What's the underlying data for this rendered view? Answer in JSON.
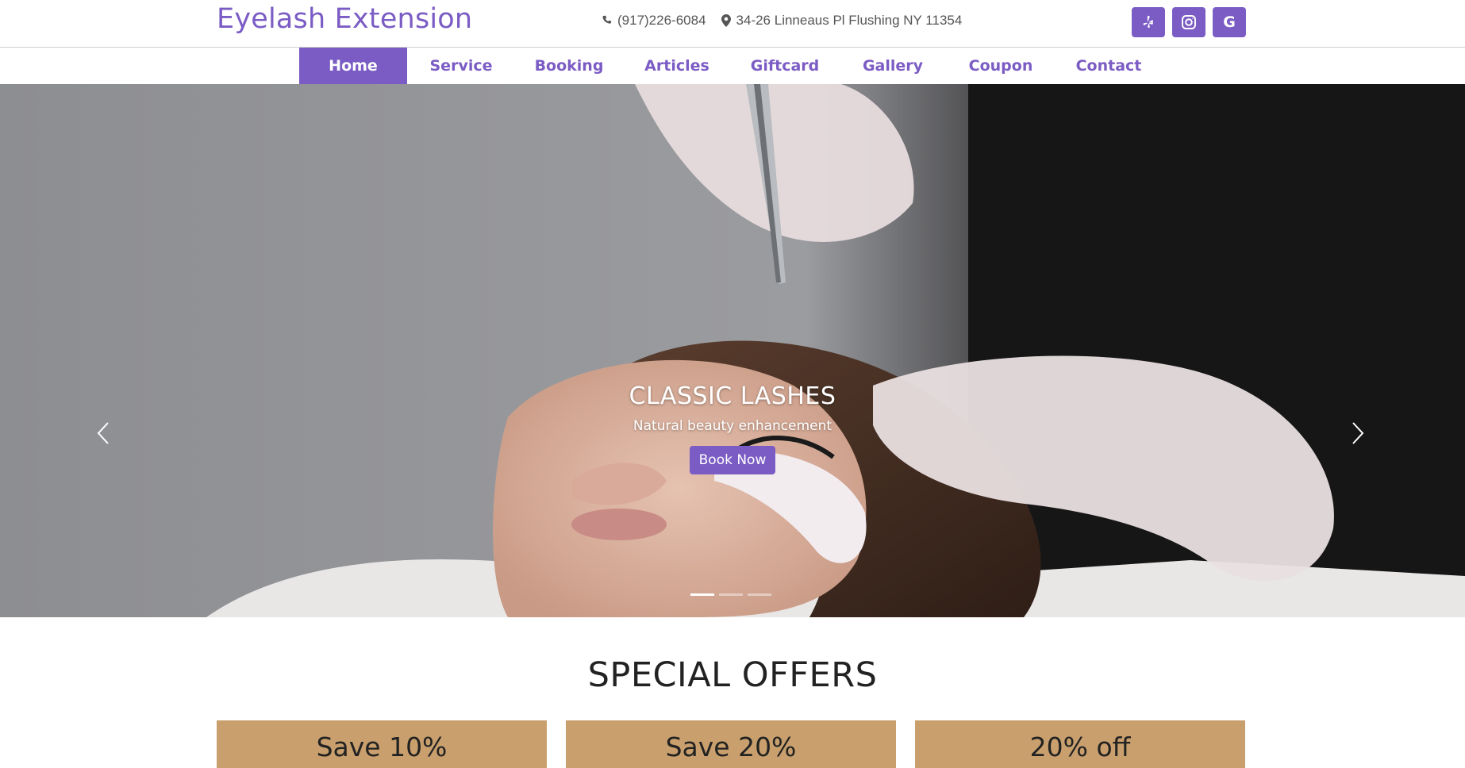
{
  "header": {
    "brand": "Eyelash Extension",
    "phone": "(917)226-6084",
    "address": "34-26 Linneaus Pl Flushing NY 11354",
    "socials": [
      {
        "name": "yelp",
        "icon": "yelp-icon"
      },
      {
        "name": "instagram",
        "icon": "instagram-icon"
      },
      {
        "name": "google",
        "icon": "google-icon",
        "glyph": "G"
      }
    ]
  },
  "nav": {
    "items": [
      {
        "label": "Home",
        "active": true
      },
      {
        "label": "Service"
      },
      {
        "label": "Booking"
      },
      {
        "label": "Articles"
      },
      {
        "label": "Giftcard"
      },
      {
        "label": "Gallery"
      },
      {
        "label": "Coupon"
      },
      {
        "label": "Contact"
      }
    ]
  },
  "hero": {
    "title": "CLASSIC LASHES",
    "subtitle": "Natural beauty enhancement",
    "cta": "Book Now",
    "slide_count": 3,
    "active_slide": 1
  },
  "offers": {
    "title": "SPECIAL OFFERS",
    "cards": [
      {
        "label": "Save 10%"
      },
      {
        "label": "Save 20%"
      },
      {
        "label": "20% off"
      }
    ]
  },
  "colors": {
    "accent": "#7b5cc4",
    "offer_card": "#c9a06d"
  }
}
